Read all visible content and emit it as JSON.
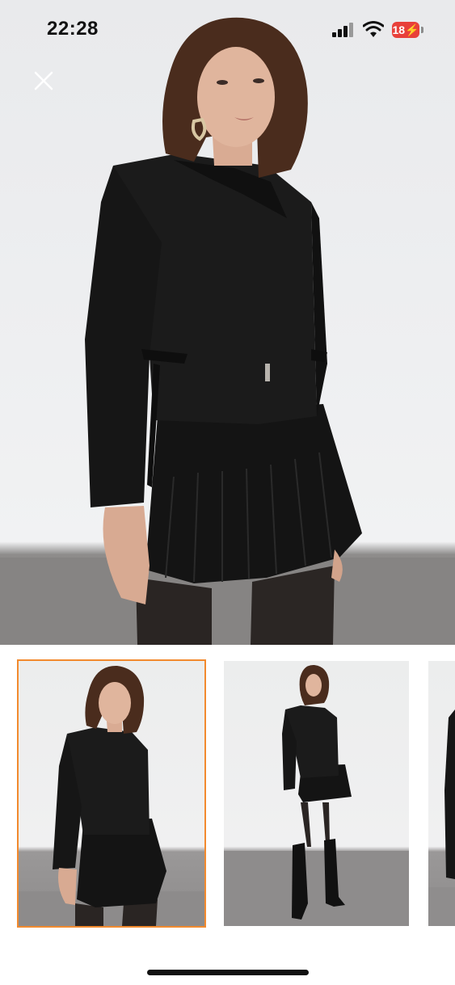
{
  "status_bar": {
    "time": "22:28",
    "battery_label": "18⚡",
    "icons": [
      "signal-icon",
      "wifi-icon",
      "battery-icon"
    ]
  },
  "viewer": {
    "close_icon": "close-icon",
    "selected_index": 0,
    "thumbnails": [
      {
        "name": "thumbnail-1",
        "selected": true
      },
      {
        "name": "thumbnail-2",
        "selected": false
      },
      {
        "name": "thumbnail-3",
        "selected": false
      }
    ]
  },
  "colors": {
    "accent": "#f28a2e",
    "battery_low": "#e8403a"
  }
}
